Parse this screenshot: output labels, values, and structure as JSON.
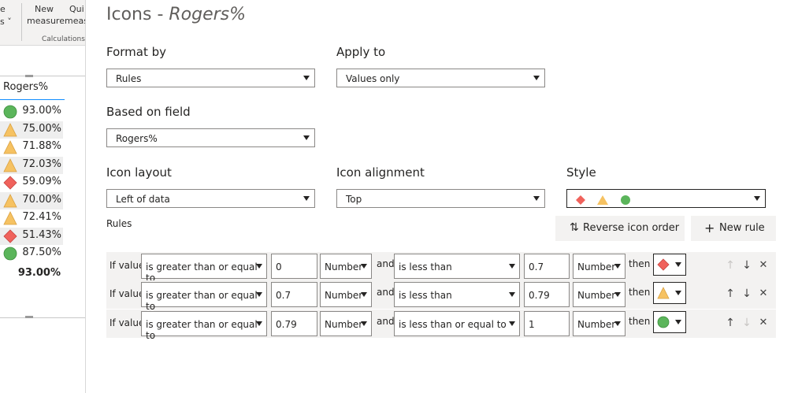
{
  "ribbon": {
    "partial_top": "e",
    "partial_bottom": "s ˅",
    "new_measure_line1": "New",
    "new_measure_line2": "measure",
    "quick_measure_line1": "Qui",
    "quick_measure_line2": "meas",
    "group_label": "Calculations"
  },
  "table": {
    "header": "Rogers%",
    "rows": [
      {
        "icon": "green-circle",
        "value": "93.00%"
      },
      {
        "icon": "yellow-triangle",
        "value": "75.00%"
      },
      {
        "icon": "yellow-triangle",
        "value": "71.88%"
      },
      {
        "icon": "yellow-triangle",
        "value": "72.03%"
      },
      {
        "icon": "red-diamond",
        "value": "59.09%"
      },
      {
        "icon": "yellow-triangle",
        "value": "70.00%"
      },
      {
        "icon": "yellow-triangle",
        "value": "72.41%"
      },
      {
        "icon": "red-diamond",
        "value": "51.43%"
      },
      {
        "icon": "green-circle",
        "value": "87.50%"
      }
    ],
    "total": "93.00%"
  },
  "dialog": {
    "title_prefix": "Icons - ",
    "title_field": "Rogers%",
    "format_by_label": "Format by",
    "format_by_value": "Rules",
    "apply_to_label": "Apply to",
    "apply_to_value": "Values only",
    "based_on_label": "Based on field",
    "based_on_value": "Rogers%",
    "icon_layout_label": "Icon layout",
    "icon_layout_value": "Left of data",
    "icon_alignment_label": "Icon alignment",
    "icon_alignment_value": "Top",
    "style_label": "Style",
    "rules_label": "Rules",
    "reverse_icon": "⇅",
    "reverse_label": "Reverse icon order",
    "new_rule_icon": "+",
    "new_rule_label": "New rule"
  },
  "rules": [
    {
      "if": "If value",
      "op1": "is greater than or equal to",
      "v1": "0",
      "t1": "Number",
      "and": "and",
      "op2": "is less than",
      "v2": "0.7",
      "t2": "Number",
      "then": "then",
      "icon": "red-diamond"
    },
    {
      "if": "If value",
      "op1": "is greater than or equal to",
      "v1": "0.7",
      "t1": "Number",
      "and": "and",
      "op2": "is less than",
      "v2": "0.79",
      "t2": "Number",
      "then": "then",
      "icon": "yellow-triangle"
    },
    {
      "if": "If value",
      "op1": "is greater than or equal to",
      "v1": "0.79",
      "t1": "Number",
      "and": "and",
      "op2": "is less than or equal to",
      "v2": "1",
      "t2": "Number",
      "then": "then",
      "icon": "green-circle"
    }
  ],
  "actions": {
    "up": "↑",
    "down": "↓",
    "delete": "✕"
  },
  "colors": {
    "red": "#f0625c",
    "yellow": "#f6c262",
    "green": "#5bb55b",
    "accent": "#118dff"
  }
}
